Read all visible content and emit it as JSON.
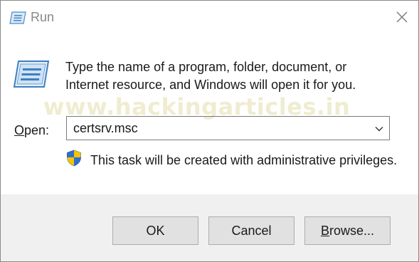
{
  "window": {
    "title": "Run",
    "icon": "run-dialog-icon"
  },
  "dialog": {
    "description_line1": "Type the name of a program, folder, document, or",
    "description_line2": "Internet resource, and Windows will open it for you.",
    "watermark": "www.hackingarticles.in",
    "open_label_mnemonic": "O",
    "open_label_rest": "pen:",
    "command_value": "certsrv.msc",
    "admin_note": "This task will be created with administrative privileges."
  },
  "buttons": {
    "ok": "OK",
    "cancel": "Cancel",
    "browse_mnemonic": "B",
    "browse_rest": "rowse..."
  },
  "colors": {
    "footer_bg": "#f0f0f0",
    "button_bg": "#e1e1e1",
    "shield_blue": "#2f6fd0",
    "shield_yellow": "#f5c400"
  }
}
